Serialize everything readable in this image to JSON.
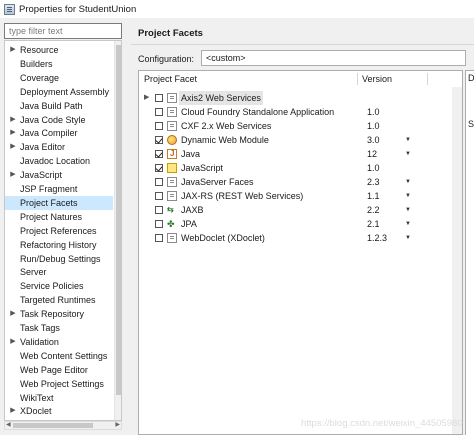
{
  "window": {
    "title": "Properties for StudentUnion"
  },
  "filter": {
    "placeholder": "type filter text",
    "value": ""
  },
  "tree": {
    "items": [
      {
        "label": "Resource",
        "expandable": true,
        "selected": false
      },
      {
        "label": "Builders",
        "expandable": false,
        "selected": false
      },
      {
        "label": "Coverage",
        "expandable": false,
        "selected": false
      },
      {
        "label": "Deployment Assembly",
        "expandable": false,
        "selected": false
      },
      {
        "label": "Java Build Path",
        "expandable": false,
        "selected": false
      },
      {
        "label": "Java Code Style",
        "expandable": true,
        "selected": false
      },
      {
        "label": "Java Compiler",
        "expandable": true,
        "selected": false
      },
      {
        "label": "Java Editor",
        "expandable": true,
        "selected": false
      },
      {
        "label": "Javadoc Location",
        "expandable": false,
        "selected": false
      },
      {
        "label": "JavaScript",
        "expandable": true,
        "selected": false
      },
      {
        "label": "JSP Fragment",
        "expandable": false,
        "selected": false
      },
      {
        "label": "Project Facets",
        "expandable": false,
        "selected": true
      },
      {
        "label": "Project Natures",
        "expandable": false,
        "selected": false
      },
      {
        "label": "Project References",
        "expandable": false,
        "selected": false
      },
      {
        "label": "Refactoring History",
        "expandable": false,
        "selected": false
      },
      {
        "label": "Run/Debug Settings",
        "expandable": false,
        "selected": false
      },
      {
        "label": "Server",
        "expandable": false,
        "selected": false
      },
      {
        "label": "Service Policies",
        "expandable": false,
        "selected": false
      },
      {
        "label": "Targeted Runtimes",
        "expandable": false,
        "selected": false
      },
      {
        "label": "Task Repository",
        "expandable": true,
        "selected": false
      },
      {
        "label": "Task Tags",
        "expandable": false,
        "selected": false
      },
      {
        "label": "Validation",
        "expandable": true,
        "selected": false
      },
      {
        "label": "Web Content Settings",
        "expandable": false,
        "selected": false
      },
      {
        "label": "Web Page Editor",
        "expandable": false,
        "selected": false
      },
      {
        "label": "Web Project Settings",
        "expandable": false,
        "selected": false
      },
      {
        "label": "WikiText",
        "expandable": false,
        "selected": false
      },
      {
        "label": "XDoclet",
        "expandable": true,
        "selected": false
      }
    ]
  },
  "main": {
    "title": "Project Facets",
    "configuration_label": "Configuration:",
    "configuration_value": "<custom>",
    "table": {
      "col_facet": "Project Facet",
      "col_version": "Version",
      "rows": [
        {
          "name": "Axis2 Web Services",
          "version": "",
          "checked": false,
          "expandable": true,
          "dropdown": false,
          "icon": "page-icon"
        },
        {
          "name": "Cloud Foundry Standalone Application",
          "version": "1.0",
          "checked": false,
          "expandable": false,
          "dropdown": false,
          "icon": "page-icon"
        },
        {
          "name": "CXF 2.x Web Services",
          "version": "1.0",
          "checked": false,
          "expandable": false,
          "dropdown": false,
          "icon": "page-icon"
        },
        {
          "name": "Dynamic Web Module",
          "version": "3.0",
          "checked": true,
          "expandable": false,
          "dropdown": true,
          "icon": "globe-icon"
        },
        {
          "name": "Java",
          "version": "12",
          "checked": true,
          "expandable": false,
          "dropdown": true,
          "icon": "java-icon"
        },
        {
          "name": "JavaScript",
          "version": "1.0",
          "checked": true,
          "expandable": false,
          "dropdown": false,
          "icon": "javascript-icon"
        },
        {
          "name": "JavaServer Faces",
          "version": "2.3",
          "checked": false,
          "expandable": false,
          "dropdown": true,
          "icon": "page-icon"
        },
        {
          "name": "JAX-RS (REST Web Services)",
          "version": "1.1",
          "checked": false,
          "expandable": false,
          "dropdown": true,
          "icon": "page-icon"
        },
        {
          "name": "JAXB",
          "version": "2.2",
          "checked": false,
          "expandable": false,
          "dropdown": true,
          "icon": "jaxb-icon"
        },
        {
          "name": "JPA",
          "version": "2.1",
          "checked": false,
          "expandable": false,
          "dropdown": true,
          "icon": "jpa-icon"
        },
        {
          "name": "WebDoclet (XDoclet)",
          "version": "1.2.3",
          "checked": false,
          "expandable": false,
          "dropdown": true,
          "icon": "page-icon"
        }
      ]
    },
    "details": {
      "line1": "D",
      "line2": "S"
    }
  },
  "watermark": "https://blog.csdn.net/weixin_44505980"
}
